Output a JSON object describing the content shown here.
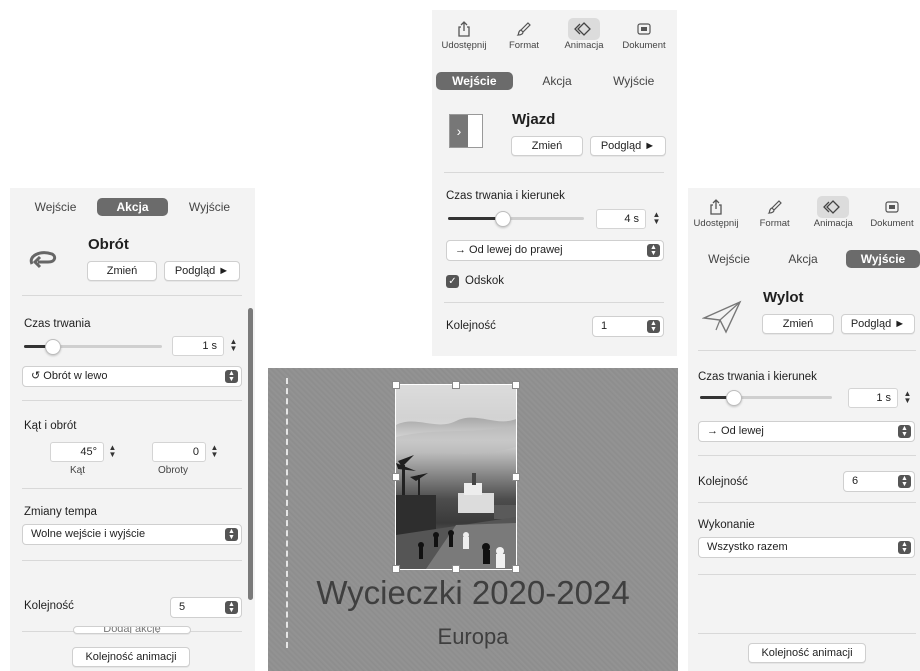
{
  "left_panel": {
    "tabs": [
      {
        "label": "Wejście",
        "active": false
      },
      {
        "label": "Akcja",
        "active": true
      },
      {
        "label": "Wyjście",
        "active": false
      }
    ],
    "effect_icon": "rotate-arrow-icon",
    "effect_title": "Obrót",
    "change_label": "Zmień",
    "preview_label": "Podgląd ►",
    "duration_label": "Czas trwania",
    "duration_value": "1 s",
    "duration_slider": 0.2,
    "direction_value": "Obrót w lewo",
    "angle_section_label": "Kąt i obrót",
    "angle_value": "45°",
    "angle_caption": "Kąt",
    "rotations_value": "0",
    "rotations_caption": "Obroty",
    "tempo_label": "Zmiany tempa",
    "tempo_value": "Wolne wejście i wyjście",
    "order_label": "Kolejność",
    "order_value": "5",
    "hidden_button_label": "Dodaj akcję",
    "animation_order_label": "Kolejność animacji"
  },
  "top_panel": {
    "toolbar": [
      {
        "label": "Udostępnij",
        "icon": "share-icon",
        "active": false
      },
      {
        "label": "Format",
        "icon": "format-brush-icon",
        "active": false
      },
      {
        "label": "Animacja",
        "icon": "animation-diamond-icon",
        "active": true
      },
      {
        "label": "Dokument",
        "icon": "document-icon",
        "active": false
      }
    ],
    "tabs": [
      {
        "label": "Wejście",
        "active": true
      },
      {
        "label": "Akcja",
        "active": false
      },
      {
        "label": "Wyjście",
        "active": false
      }
    ],
    "effect_icon": "move-in-icon",
    "effect_title": "Wjazd",
    "change_label": "Zmień",
    "preview_label": "Podgląd ►",
    "duration_label": "Czas trwania i kierunek",
    "duration_value": "4 s",
    "duration_slider": 0.4,
    "direction_value": "→ Od lewej do prawej",
    "bounce_label": "Odskok",
    "bounce_checked": true,
    "order_label": "Kolejność",
    "order_value": "1"
  },
  "right_panel": {
    "toolbar": [
      {
        "label": "Udostępnij",
        "icon": "share-icon",
        "active": false
      },
      {
        "label": "Format",
        "icon": "format-brush-icon",
        "active": false
      },
      {
        "label": "Animacja",
        "icon": "animation-diamond-icon",
        "active": true
      },
      {
        "label": "Dokument",
        "icon": "document-icon",
        "active": false
      }
    ],
    "tabs": [
      {
        "label": "Wejście",
        "active": false
      },
      {
        "label": "Akcja",
        "active": false
      },
      {
        "label": "Wyjście",
        "active": true
      }
    ],
    "effect_icon": "paper-plane-icon",
    "effect_title": "Wylot",
    "change_label": "Zmień",
    "preview_label": "Podgląd ►",
    "duration_label": "Czas trwania i kierunek",
    "duration_value": "1 s",
    "duration_slider": 0.25,
    "direction_value": "→ Od lewej",
    "order_label": "Kolejność",
    "order_value": "6",
    "execution_label": "Wykonanie",
    "execution_value": "Wszystko razem",
    "animation_order_label": "Kolejność animacji"
  },
  "slide": {
    "title": "Wycieczki 2020-2024",
    "subtitle": "Europa"
  }
}
